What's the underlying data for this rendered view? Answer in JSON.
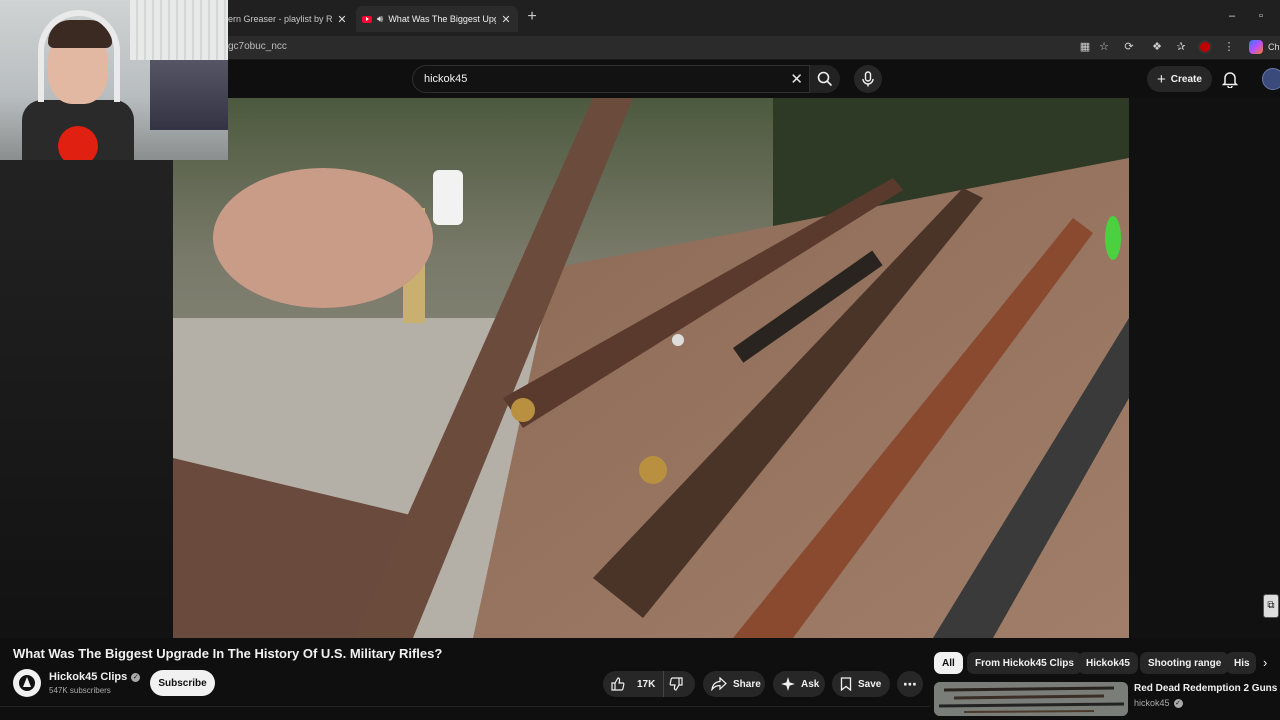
{
  "browser": {
    "tabs": [
      {
        "title": "ern Greaser - playlist by Rich"
      },
      {
        "title": "What Was The Biggest Upgrade In The History Of U.S. Military Rifles?"
      }
    ],
    "url": "gc7obuc_ncc",
    "copilot_label": "Ch",
    "window_controls": {
      "minimize": "–",
      "restore": "▫"
    }
  },
  "youtube": {
    "search": {
      "query": "hickok45"
    },
    "create_label": "Create"
  },
  "video": {
    "title": "What Was The Biggest Upgrade In The History Of U.S. Military Rifles?",
    "channel_name": "Hickok45 Clips",
    "subscribers": "547K subscribers",
    "subscribe_label": "Subscribe",
    "likes": "17K",
    "actions": {
      "share": "Share",
      "ask": "Ask",
      "save": "Save"
    }
  },
  "chips": [
    {
      "label": "All",
      "active": true
    },
    {
      "label": "From Hickok45 Clips"
    },
    {
      "label": "Hickok45"
    },
    {
      "label": "Shooting range"
    },
    {
      "label": "His"
    }
  ],
  "recommendation": {
    "title": "Red Dead Redemption 2 Guns",
    "channel": "hickok45"
  },
  "colors": {
    "brand_red": "#ff0033",
    "background": "#0f0f0f",
    "surface": "#272727"
  }
}
